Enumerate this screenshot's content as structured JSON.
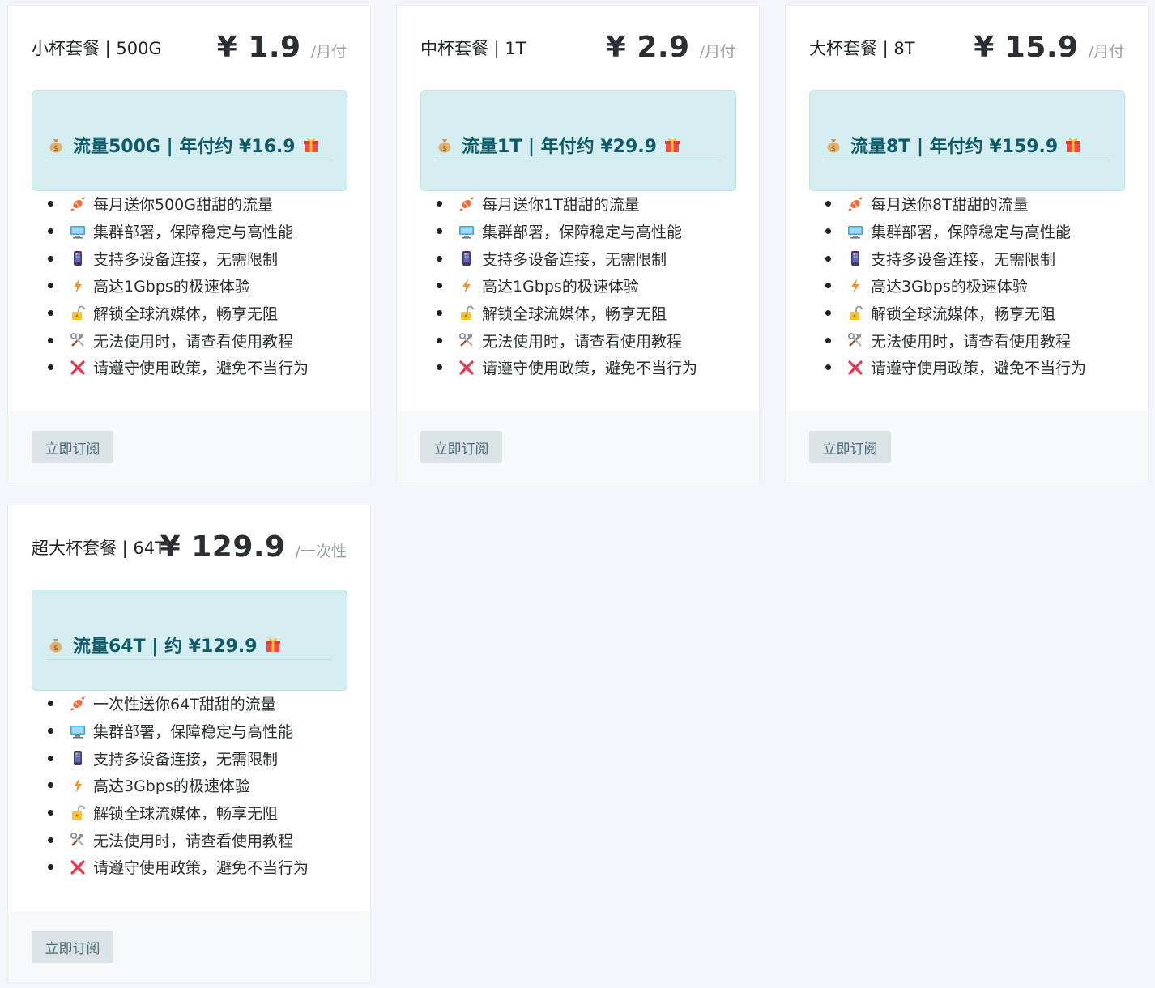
{
  "plans": [
    {
      "name": "小杯套餐 | 500G",
      "price": "¥ 1.9",
      "period": "/月付",
      "highlight": "流量500G | 年付约 ¥16.9",
      "features": [
        {
          "icon": "candy-icon",
          "text": "每月送你500G甜甜的流量"
        },
        {
          "icon": "desktop-icon",
          "text": "集群部署，保障稳定与高性能"
        },
        {
          "icon": "mobile-phone-icon",
          "text": "支持多设备连接，无需限制"
        },
        {
          "icon": "lightning-icon",
          "text": "高达1Gbps的极速体验"
        },
        {
          "icon": "unlock-icon",
          "text": "解锁全球流媒体，畅享无阻"
        },
        {
          "icon": "tools-icon",
          "text": "无法使用时，请查看使用教程"
        },
        {
          "icon": "cross-mark-icon",
          "text": "请遵守使用政策，避免不当行为"
        }
      ],
      "button": "立即订阅"
    },
    {
      "name": "中杯套餐 | 1T",
      "price": "¥ 2.9",
      "period": "/月付",
      "highlight": "流量1T | 年付约 ¥29.9",
      "features": [
        {
          "icon": "candy-icon",
          "text": "每月送你1T甜甜的流量"
        },
        {
          "icon": "desktop-icon",
          "text": "集群部署，保障稳定与高性能"
        },
        {
          "icon": "mobile-phone-icon",
          "text": "支持多设备连接，无需限制"
        },
        {
          "icon": "lightning-icon",
          "text": "高达1Gbps的极速体验"
        },
        {
          "icon": "unlock-icon",
          "text": "解锁全球流媒体，畅享无阻"
        },
        {
          "icon": "tools-icon",
          "text": "无法使用时，请查看使用教程"
        },
        {
          "icon": "cross-mark-icon",
          "text": "请遵守使用政策，避免不当行为"
        }
      ],
      "button": "立即订阅"
    },
    {
      "name": "大杯套餐 | 8T",
      "price": "¥ 15.9",
      "period": "/月付",
      "highlight": "流量8T | 年付约 ¥159.9",
      "features": [
        {
          "icon": "candy-icon",
          "text": "每月送你8T甜甜的流量"
        },
        {
          "icon": "desktop-icon",
          "text": "集群部署，保障稳定与高性能"
        },
        {
          "icon": "mobile-phone-icon",
          "text": "支持多设备连接，无需限制"
        },
        {
          "icon": "lightning-icon",
          "text": "高达3Gbps的极速体验"
        },
        {
          "icon": "unlock-icon",
          "text": "解锁全球流媒体，畅享无阻"
        },
        {
          "icon": "tools-icon",
          "text": "无法使用时，请查看使用教程"
        },
        {
          "icon": "cross-mark-icon",
          "text": "请遵守使用政策，避免不当行为"
        }
      ],
      "button": "立即订阅"
    },
    {
      "name": "超大杯套餐 | 64T",
      "price": "¥ 129.9",
      "period": "/一次性",
      "highlight": "流量64T | 约 ¥129.9",
      "features": [
        {
          "icon": "candy-icon",
          "text": "一次性送你64T甜甜的流量"
        },
        {
          "icon": "desktop-icon",
          "text": "集群部署，保障稳定与高性能"
        },
        {
          "icon": "mobile-phone-icon",
          "text": "支持多设备连接，无需限制"
        },
        {
          "icon": "lightning-icon",
          "text": "高达3Gbps的极速体验"
        },
        {
          "icon": "unlock-icon",
          "text": "解锁全球流媒体，畅享无阻"
        },
        {
          "icon": "tools-icon",
          "text": "无法使用时，请查看使用教程"
        },
        {
          "icon": "cross-mark-icon",
          "text": "请遵守使用政策，避免不当行为"
        }
      ],
      "button": "立即订阅"
    }
  ],
  "colors": {
    "page_background": "#f4f5fa",
    "highlight_background": "#d3edf1",
    "highlight_text": "#0f5a66",
    "button_background": "#dbe3e6",
    "button_text": "#4a6a74",
    "price_period": "#9aa0a6"
  }
}
